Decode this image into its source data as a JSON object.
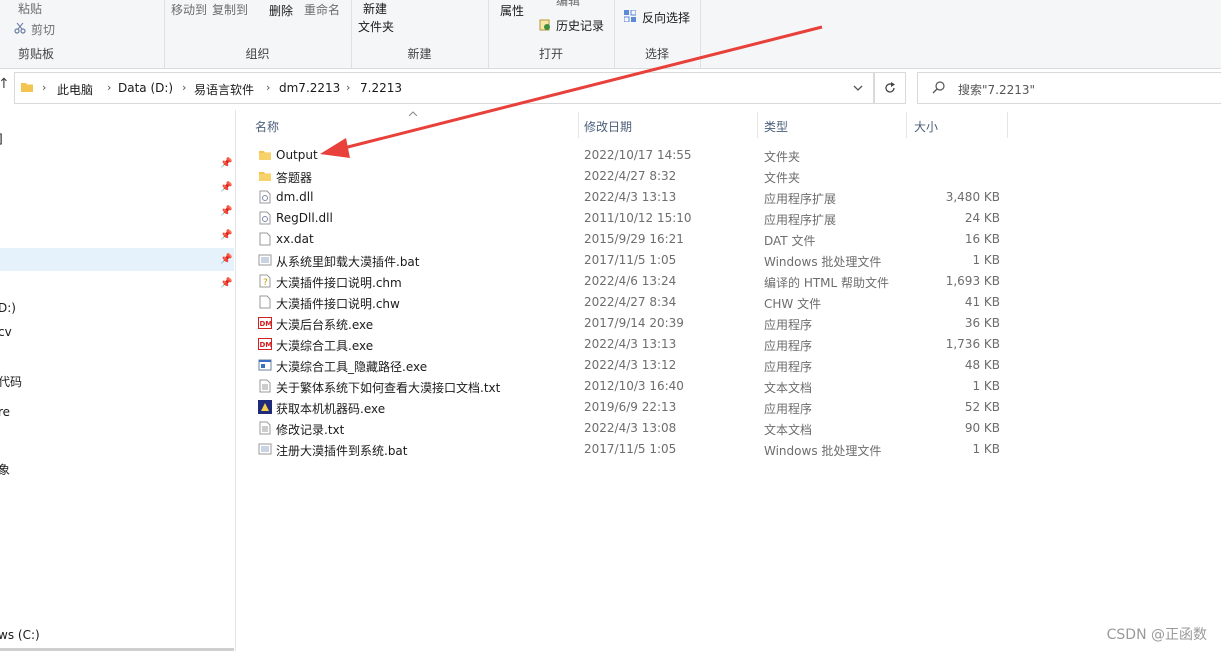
{
  "ribbon": {
    "clipboard": {
      "paste": "粘贴",
      "cut": "剪切",
      "label": "剪贴板"
    },
    "organize": {
      "move_to": "移动到",
      "copy_to": "复制到",
      "delete": "删除",
      "rename": "重命名",
      "label": "组织"
    },
    "new": {
      "new_folder_line1": "新建",
      "new_folder_line2": "文件夹",
      "label": "新建"
    },
    "open": {
      "properties": "属性",
      "edit": "编辑",
      "history": "历史记录",
      "label": "打开"
    },
    "select": {
      "invert": "反向选择",
      "label": "选择"
    }
  },
  "address": {
    "up": "↑",
    "crumbs": [
      "此电脑",
      "Data (D:)",
      "易语言软件",
      "dm7.2213",
      "7.2213"
    ],
    "search_placeholder": "搜索\"7.2213\""
  },
  "nav": {
    "items": [
      {
        "label": "]"
      },
      {
        "label": "D:)"
      },
      {
        "label": "cv"
      },
      {
        "label": "代码"
      },
      {
        "label": "re"
      },
      {
        "label": "象"
      },
      {
        "label": "ws (C:)"
      }
    ]
  },
  "columns": {
    "name": "名称",
    "date": "修改日期",
    "type": "类型",
    "size": "大小"
  },
  "files": [
    {
      "name": "Output",
      "date": "2022/10/17 14:55",
      "type": "文件夹",
      "size": "",
      "icon": "folder-icon"
    },
    {
      "name": "答题器",
      "date": "2022/4/27 8:32",
      "type": "文件夹",
      "size": "",
      "icon": "folder-icon"
    },
    {
      "name": "dm.dll",
      "date": "2022/4/3 13:13",
      "type": "应用程序扩展",
      "size": "3,480 KB",
      "icon": "dll-icon"
    },
    {
      "name": "RegDll.dll",
      "date": "2011/10/12 15:10",
      "type": "应用程序扩展",
      "size": "24 KB",
      "icon": "dll-icon"
    },
    {
      "name": "xx.dat",
      "date": "2015/9/29 16:21",
      "type": "DAT 文件",
      "size": "16 KB",
      "icon": "file-icon"
    },
    {
      "name": "从系统里卸载大漠插件.bat",
      "date": "2017/11/5 1:05",
      "type": "Windows 批处理文件",
      "size": "1 KB",
      "icon": "bat-icon"
    },
    {
      "name": "大漠插件接口说明.chm",
      "date": "2022/4/6 13:24",
      "type": "编译的 HTML 帮助文件",
      "size": "1,693 KB",
      "icon": "chm-icon"
    },
    {
      "name": "大漠插件接口说明.chw",
      "date": "2022/4/27 8:34",
      "type": "CHW 文件",
      "size": "41 KB",
      "icon": "file-icon"
    },
    {
      "name": "大漠后台系统.exe",
      "date": "2017/9/14 20:39",
      "type": "应用程序",
      "size": "36 KB",
      "icon": "dm-exe-icon"
    },
    {
      "name": "大漠综合工具.exe",
      "date": "2022/4/3 13:13",
      "type": "应用程序",
      "size": "1,736 KB",
      "icon": "dm-exe-icon"
    },
    {
      "name": "大漠综合工具_隐藏路径.exe",
      "date": "2022/4/3 13:12",
      "type": "应用程序",
      "size": "48 KB",
      "icon": "app-icon"
    },
    {
      "name": "关于繁体系统下如何查看大漠接口文档.txt",
      "date": "2012/10/3 16:40",
      "type": "文本文档",
      "size": "1 KB",
      "icon": "txt-icon"
    },
    {
      "name": "获取本机机器码.exe",
      "date": "2019/6/9 22:13",
      "type": "应用程序",
      "size": "52 KB",
      "icon": "tool-exe-icon"
    },
    {
      "name": "修改记录.txt",
      "date": "2022/4/3 13:08",
      "type": "文本文档",
      "size": "90 KB",
      "icon": "txt-icon"
    },
    {
      "name": "注册大漠插件到系统.bat",
      "date": "2017/11/5 1:05",
      "type": "Windows 批处理文件",
      "size": "1 KB",
      "icon": "bat-icon"
    }
  ],
  "watermark": "CSDN @正函数",
  "colors": {
    "arrow": "#e8403a",
    "folder": "#f3c44f",
    "header_text": "#4c607a"
  }
}
